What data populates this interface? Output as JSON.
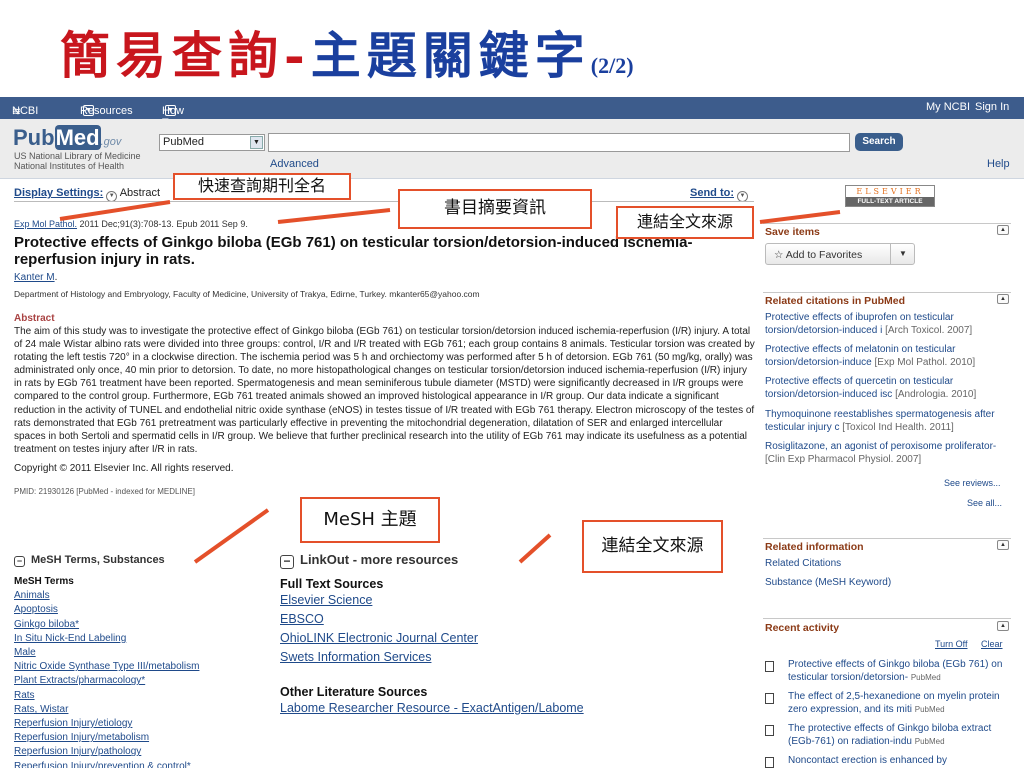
{
  "slide": {
    "title_red": "簡易查詢-",
    "title_blue": "主題關鍵字",
    "title_page": "(2/2)"
  },
  "ncbi_bar": {
    "logo": "NCBI",
    "resources": "Resources",
    "howto": "How To",
    "my_ncbi": "My NCBI",
    "sign_in": "Sign In"
  },
  "header": {
    "logo_pub": "Pub",
    "logo_med": "Med",
    "logo_gov": ".gov",
    "library_text": "US National Library of Medicine National Institutes of Health",
    "database_selected": "PubMed",
    "search_value": "",
    "search_button": "Search",
    "advanced": "Advanced",
    "help": "Help"
  },
  "display": {
    "settings_label": "Display Settings:",
    "settings_value": "Abstract",
    "send_to": "Send to:"
  },
  "article": {
    "citation_journal": "Exp Mol Pathol.",
    "citation_rest": " 2011 Dec;91(3):708-13. Epub 2011 Sep 9.",
    "title": "Protective effects of Ginkgo biloba (EGb 761) on testicular torsion/detorsion-induced ischemia-reperfusion injury in rats.",
    "author": "Kanter M",
    "affiliation": "Department of Histology and Embryology, Faculty of Medicine, University of Trakya, Edirne, Turkey. mkanter65@yahoo.com",
    "abstract_heading": "Abstract",
    "abstract": "The aim of this study was to investigate the protective effect of Ginkgo biloba (EGb 761) on testicular torsion/detorsion induced ischemia-reperfusion (I/R) injury. A total of 24 male Wistar albino rats were divided into three groups: control, I/R and I/R treated with EGb 761; each group contains 8 animals. Testicular torsion was created by rotating the left testis 720° in a clockwise direction. The ischemia period was 5 h and orchiectomy was performed after 5 h of detorsion. EGb 761 (50 mg/kg, orally) was administrated only once, 40 min prior to detorsion. To date, no more histopathological changes on testicular torsion/detorsion induced ischemia-reperfusion (I/R) injury in rats by EGb 761 treatment have been reported. Spermatogenesis and mean seminiferous tubule diameter (MSTD) were significantly decreased in I/R groups were compared to the control group. Furthermore, EGb 761 treated animals showed an improved histological appearance in I/R group. Our data indicate a significant reduction in the activity of TUNEL and endothelial nitric oxide synthase (eNOS) in testes tissue of I/R treated with EGb 761 therapy. Electron microscopy of the testes of rats demonstrated that EGb 761 pretreatment was particularly effective in preventing the mitochondrial degeneration, dilatation of SER and enlarged intercellular spaces in both Sertoli and spermatid cells in I/R group. We believe that further preclinical research into the utility of EGb 761 may indicate its usefulness as a potential treatment on testes injury after I/R in rats.",
    "copyright": "Copyright © 2011 Elsevier Inc. All rights reserved.",
    "pmid": "PMID: 21930126 [PubMed - indexed for MEDLINE]"
  },
  "mesh": {
    "section_title": "MeSH Terms, Substances",
    "terms_heading": "MeSH Terms",
    "terms": [
      "Animals",
      "Apoptosis",
      "Ginkgo biloba*",
      "In Situ Nick-End Labeling",
      "Male",
      "Nitric Oxide Synthase Type III/metabolism",
      "Plant Extracts/pharmacology*",
      "Rats",
      "Rats, Wistar",
      "Reperfusion Injury/etiology",
      "Reperfusion Injury/metabolism",
      "Reperfusion Injury/pathology",
      "Reperfusion Injury/prevention & control*"
    ]
  },
  "linkout": {
    "section_title": "LinkOut - more resources",
    "full_text_heading": "Full Text Sources",
    "full_text": [
      "Elsevier Science",
      "EBSCO",
      "OhioLINK Electronic Journal Center",
      "Swets Information Services"
    ],
    "other_heading": "Other Literature Sources",
    "other": [
      "Labome Researcher Resource - ExactAntigen/Labome"
    ]
  },
  "sidebar": {
    "elsevier_logo": "ELSEVIER",
    "elsevier_sub": "FULL-TEXT ARTICLE",
    "save_items": "Save items",
    "add_favorites": "Add to Favorites",
    "related_citations_head": "Related citations in PubMed",
    "related": [
      {
        "title": "Protective effects of ibuprofen on testicular torsion/detorsion-induced i",
        "src": "[Arch Toxicol. 2007]"
      },
      {
        "title": "Protective effects of melatonin on testicular torsion/detorsion-induce",
        "src": "[Exp Mol Pathol. 2010]"
      },
      {
        "title": "Protective effects of quercetin on testicular torsion/detorsion-induced isc",
        "src": "[Andrologia. 2010]"
      },
      {
        "title": "Thymoquinone reestablishes spermatogenesis after testicular injury c",
        "src": "[Toxicol Ind Health. 2011]"
      },
      {
        "title": "Rosiglitazone, an agonist of peroxisome proliferator-",
        "src": "[Clin Exp Pharmacol Physiol. 2007]"
      }
    ],
    "see_reviews": "See reviews...",
    "see_all": "See all...",
    "related_info_head": "Related information",
    "related_info": [
      "Related Citations",
      "Substance (MeSH Keyword)"
    ],
    "recent_head": "Recent activity",
    "turn_off": "Turn Off",
    "clear": "Clear",
    "recent": [
      {
        "title": "Protective effects of Ginkgo biloba (EGb 761) on testicular torsion/detorsion-",
        "src": "PubMed"
      },
      {
        "title": "The effect of 2,5-hexanedione on myelin protein zero expression, and its miti",
        "src": "PubMed"
      },
      {
        "title": "The protective effects of Ginkgo biloba extract (EGb-761) on radiation-indu",
        "src": "PubMed"
      },
      {
        "title": "Noncontact erection is enhanced by",
        "src": ""
      }
    ]
  },
  "annotations": {
    "journal": "快速查詢期刊全名",
    "bib": "書目摘要資訊",
    "fulltext_top": "連結全文來源",
    "mesh": "MeSH 主題",
    "fulltext_bottom": "連結全文來源"
  },
  "colors": {
    "annotation": "#e4502a",
    "title_red": "#c8161d",
    "title_blue": "#1a3f9e",
    "ncbi_bar": "#3d5c8c",
    "sidebar_heading": "#8b3a16"
  }
}
